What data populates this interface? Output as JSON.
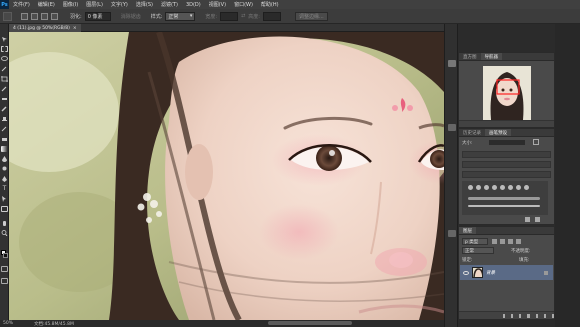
{
  "app": {
    "logo": "Ps"
  },
  "menu": [
    "文件(F)",
    "编辑(E)",
    "图像(I)",
    "图层(L)",
    "文字(Y)",
    "选择(S)",
    "滤镜(T)",
    "3D(D)",
    "视图(V)",
    "窗口(W)",
    "帮助(H)"
  ],
  "options": {
    "feather_label": "羽化:",
    "feather_value": "0 像素",
    "antialias_label": "消除锯齿",
    "style_label": "样式:",
    "style_value": "正常",
    "width_label": "宽度:",
    "height_label": "高度:",
    "refine_edge": "调整边缘..."
  },
  "document": {
    "tab_label": "4 (11).jpg @ 50%(RGB/8)",
    "close_glyph": "×"
  },
  "status": {
    "zoom": "50%",
    "doc_info": "文档:45.8M/45.8M"
  },
  "navigator": {
    "tabs": [
      "直方图",
      "导航器"
    ],
    "active": 1
  },
  "brushes": {
    "tabs": [
      "历史记录",
      "画笔预设"
    ],
    "active": 1,
    "size_label": "大小:"
  },
  "layers": {
    "tabs": [
      "图层"
    ],
    "kind_label": "p 类型",
    "blend_mode": "正常",
    "opacity_label": "不透明度:",
    "lock_label": "锁定:",
    "fill_label": "填充:",
    "layer_name": "背景"
  },
  "colors": {
    "accent": "#5a6a86",
    "ui_dark": "#2b2b2b",
    "nav_view_box": "#ff2222"
  },
  "icons": [
    "move-icon",
    "marquee-icon",
    "lasso-icon",
    "quick-select-icon",
    "crop-icon",
    "eyedropper-icon",
    "healing-icon",
    "brush-icon",
    "stamp-icon",
    "history-brush-icon",
    "eraser-icon",
    "gradient-icon",
    "blur-icon",
    "dodge-icon",
    "pen-icon",
    "type-icon",
    "path-select-icon",
    "shape-icon",
    "hand-icon",
    "zoom-icon"
  ]
}
